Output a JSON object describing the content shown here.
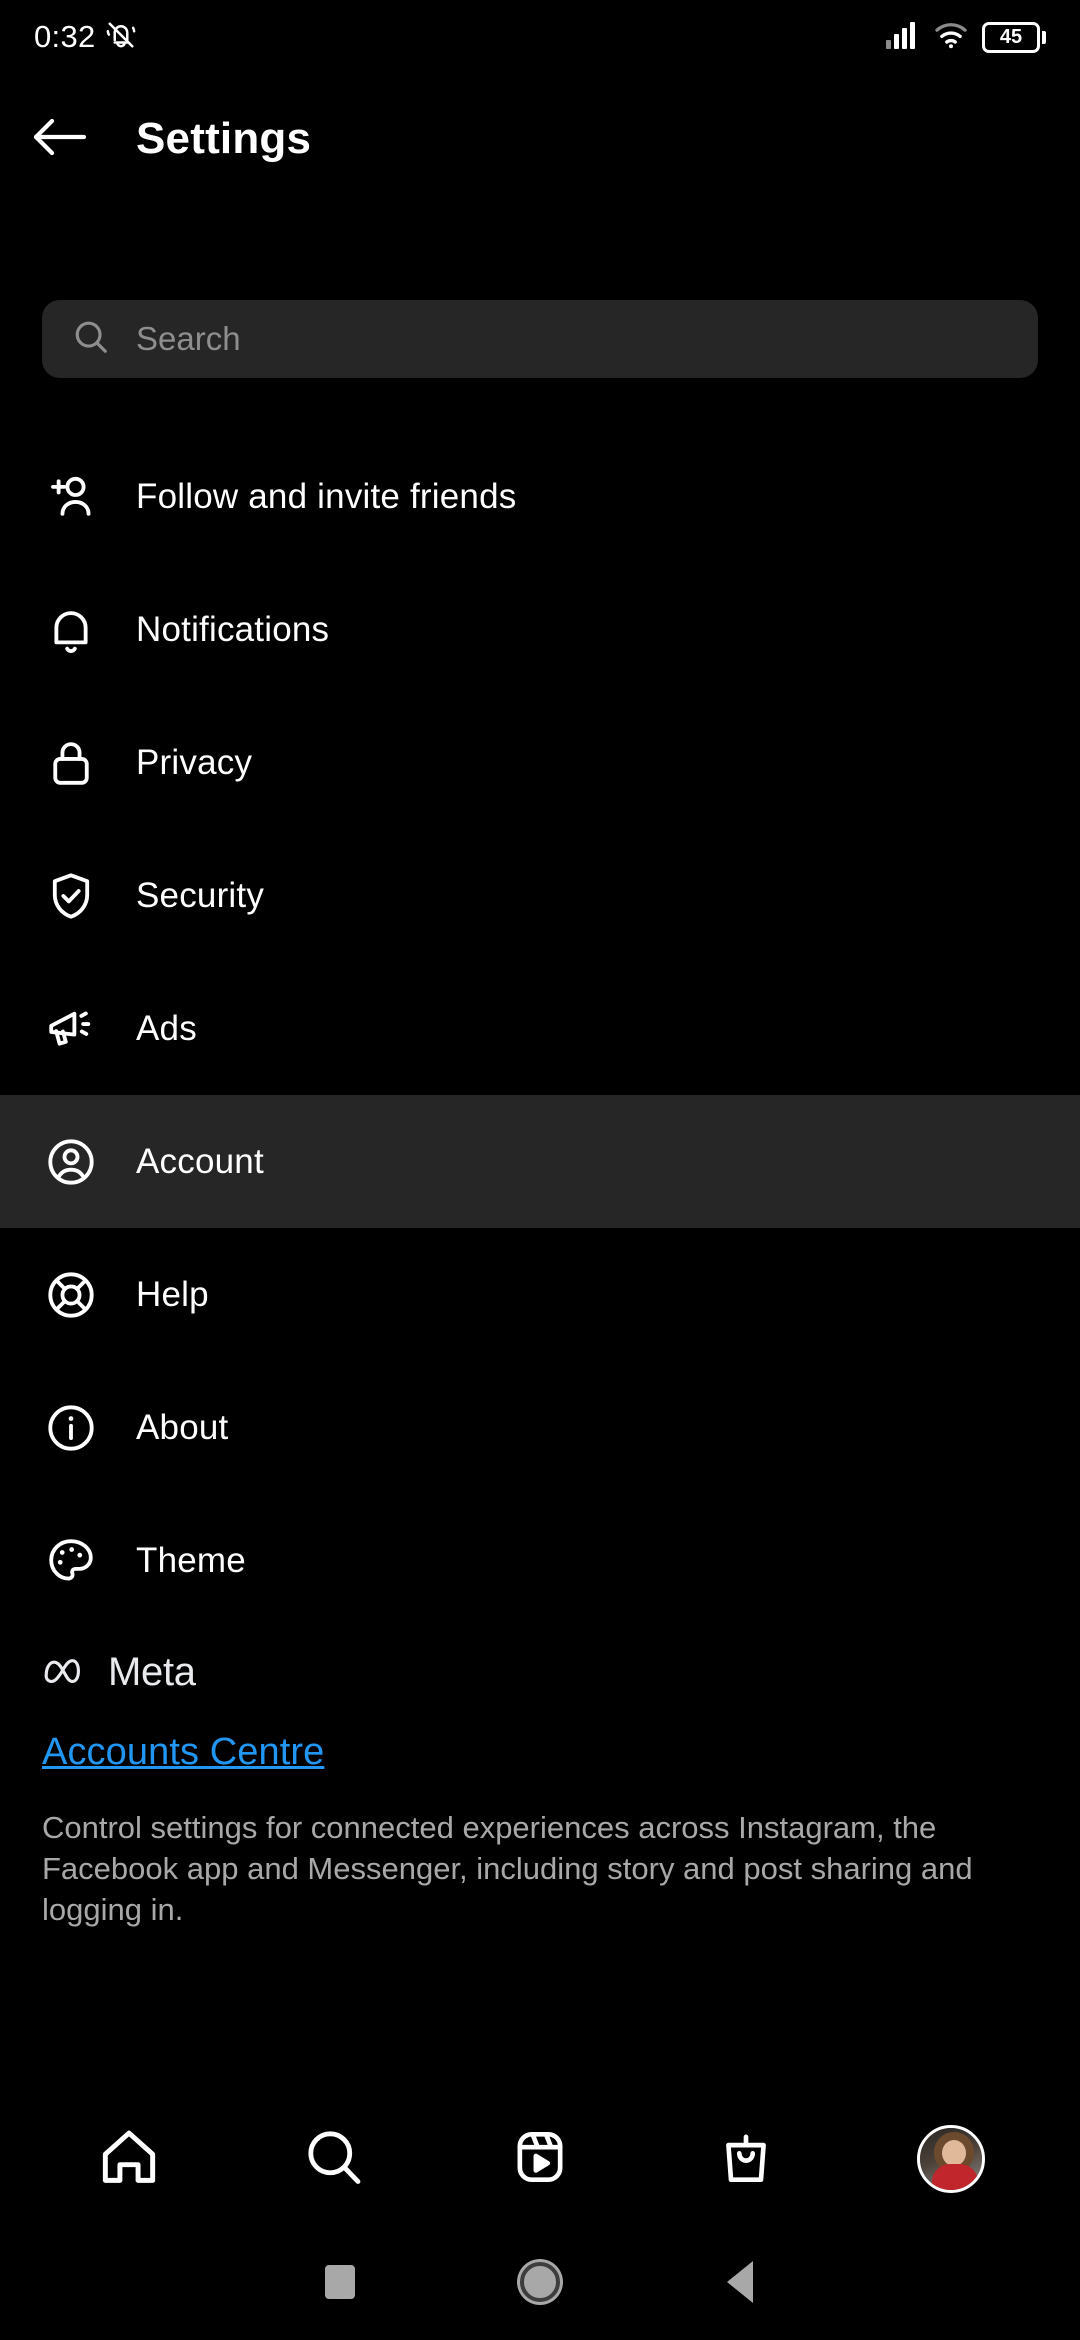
{
  "status_bar": {
    "clock": "0:32",
    "silent_icon": "bell-slash-vibrate-icon",
    "signal_icon": "cellular-signal-icon",
    "wifi_icon": "wifi-icon",
    "battery_level": "45"
  },
  "app_bar": {
    "back_icon": "back-arrow-icon",
    "title": "Settings"
  },
  "search": {
    "icon": "search-icon",
    "placeholder": "Search",
    "value": ""
  },
  "settings_items": [
    {
      "label": "Follow and invite friends",
      "icon": "person-plus-icon",
      "active": false
    },
    {
      "label": "Notifications",
      "icon": "bell-icon",
      "active": false
    },
    {
      "label": "Privacy",
      "icon": "lock-icon",
      "active": false
    },
    {
      "label": "Security",
      "icon": "shield-check-icon",
      "active": false
    },
    {
      "label": "Ads",
      "icon": "megaphone-icon",
      "active": false
    },
    {
      "label": "Account",
      "icon": "account-circle-icon",
      "active": true
    },
    {
      "label": "Help",
      "icon": "life-ring-icon",
      "active": false
    },
    {
      "label": "About",
      "icon": "info-circle-icon",
      "active": false
    },
    {
      "label": "Theme",
      "icon": "palette-icon",
      "active": false
    }
  ],
  "meta": {
    "logo_icon": "meta-infinity-icon",
    "wordmark": "Meta",
    "link_label": "Accounts Centre",
    "description": "Control settings for connected experiences across Instagram, the Facebook app and Messenger, including story and post sharing and logging in."
  },
  "bottom_nav": [
    {
      "name": "home",
      "icon": "home-icon"
    },
    {
      "name": "search",
      "icon": "search-icon"
    },
    {
      "name": "reels",
      "icon": "reels-play-icon"
    },
    {
      "name": "shop",
      "icon": "shopping-bag-icon"
    },
    {
      "name": "profile",
      "icon": "profile-avatar"
    }
  ],
  "android_nav": [
    {
      "name": "recents",
      "icon": "square-icon"
    },
    {
      "name": "home",
      "icon": "circle-icon"
    },
    {
      "name": "back",
      "icon": "triangle-back-icon"
    }
  ],
  "colors": {
    "background": "#000000",
    "surface": "#262626",
    "link_blue": "#2196f3",
    "muted_text": "#a8a8a8",
    "placeholder": "#8e8e8e"
  }
}
